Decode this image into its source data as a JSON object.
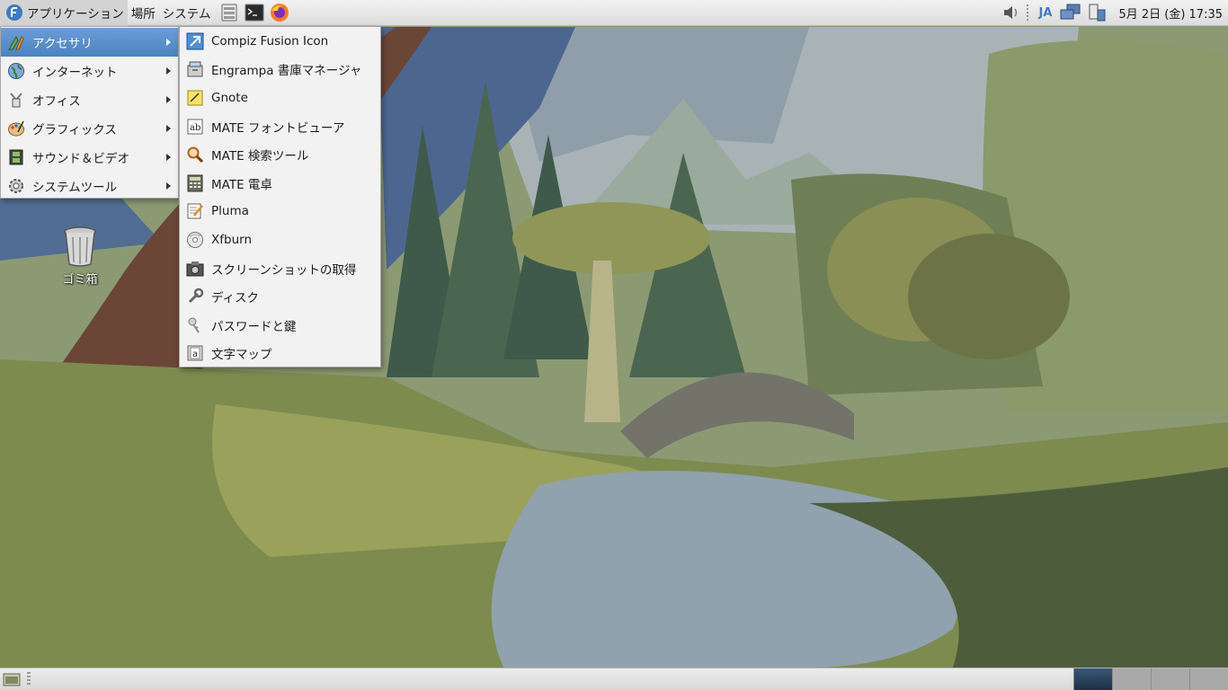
{
  "top_panel": {
    "applications_label": "アプリケーション",
    "places_label": "場所",
    "system_label": "システム",
    "launchers": [
      "system-monitor-icon",
      "terminal-icon",
      "firefox-icon"
    ],
    "tray": {
      "volume_icon": "speaker-icon",
      "language": "JA",
      "network_icon": "network-icon",
      "power_icon": "power-icon"
    },
    "clock": "5月 2日 (金) 17:35"
  },
  "applications_menu": {
    "items": [
      {
        "label": "アクセサリ",
        "icon": "accessories-icon",
        "selected": true
      },
      {
        "label": "インターネット",
        "icon": "globe-icon",
        "selected": false
      },
      {
        "label": "オフィス",
        "icon": "office-icon",
        "selected": false
      },
      {
        "label": "グラフィックス",
        "icon": "palette-icon",
        "selected": false
      },
      {
        "label": "サウンド＆ビデオ",
        "icon": "film-icon",
        "selected": false
      },
      {
        "label": "システムツール",
        "icon": "gear-icon",
        "selected": false
      }
    ]
  },
  "accessories_submenu": {
    "items": [
      {
        "label": "Compiz Fusion Icon",
        "icon": "compiz-icon"
      },
      {
        "label": "Engrampa 書庫マネージャ",
        "icon": "archive-icon"
      },
      {
        "label": "Gnote",
        "icon": "note-icon"
      },
      {
        "label": "MATE フォントビューア",
        "icon": "font-icon"
      },
      {
        "label": "MATE 検索ツール",
        "icon": "search-icon"
      },
      {
        "label": "MATE 電卓",
        "icon": "calculator-icon"
      },
      {
        "label": "Pluma",
        "icon": "text-editor-icon"
      },
      {
        "label": "Xfburn",
        "icon": "disc-icon"
      },
      {
        "label": "スクリーンショットの取得",
        "icon": "camera-icon"
      },
      {
        "label": "ディスク",
        "icon": "wrench-icon"
      },
      {
        "label": "パスワードと鍵",
        "icon": "keys-icon"
      },
      {
        "label": "文字マップ",
        "icon": "charmap-icon"
      }
    ]
  },
  "desktop": {
    "trash_label": "ゴミ箱"
  },
  "bottom_panel": {
    "workspaces": 4,
    "active_workspace": 1
  }
}
